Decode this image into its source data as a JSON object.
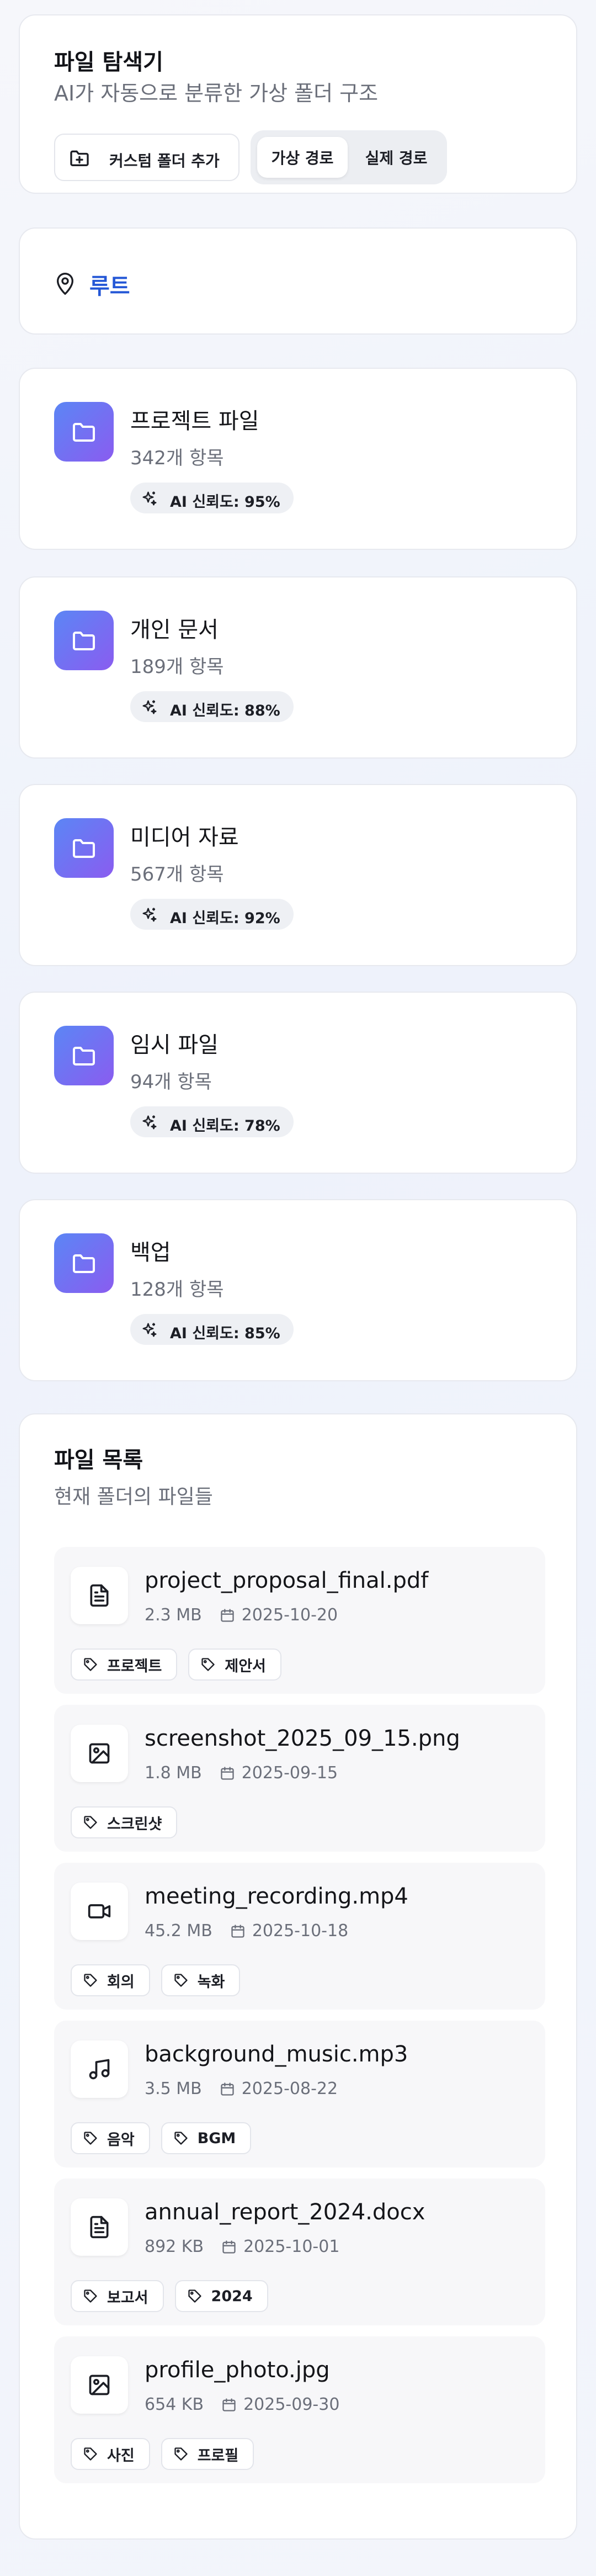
{
  "header": {
    "title": "파일 탐색기",
    "subtitle": "AI가 자동으로 분류한 가상 폴더 구조",
    "add_folder_label": "커스텀 폴더 추가",
    "toggle": {
      "virtual_label": "가상 경로",
      "real_label": "실제 경로",
      "selected": "가상 경로"
    }
  },
  "breadcrumb": {
    "root_label": "루트"
  },
  "folders": [
    {
      "name": "프로젝트 파일",
      "count": "342개 항목",
      "ai": "AI 신뢰도: 95%",
      "ai_confidence_percent": 95
    },
    {
      "name": "개인 문서",
      "count": "189개 항목",
      "ai": "AI 신뢰도: 88%",
      "ai_confidence_percent": 88
    },
    {
      "name": "미디어 자료",
      "count": "567개 항목",
      "ai": "AI 신뢰도: 92%",
      "ai_confidence_percent": 92
    },
    {
      "name": "임시 파일",
      "count": "94개 항목",
      "ai": "AI 신뢰도: 78%",
      "ai_confidence_percent": 78
    },
    {
      "name": "백업",
      "count": "128개 항목",
      "ai": "AI 신뢰도: 85%",
      "ai_confidence_percent": 85
    }
  ],
  "files_section": {
    "title": "파일 목록",
    "subtitle": "현재 폴더의 파일들"
  },
  "files": [
    {
      "name": "project_proposal_final.pdf",
      "size": "2.3 MB",
      "date": "2025-10-20",
      "icon": "document-icon",
      "tags": [
        "프로젝트",
        "제안서"
      ]
    },
    {
      "name": "screenshot_2025_09_15.png",
      "size": "1.8 MB",
      "date": "2025-09-15",
      "icon": "image-icon",
      "tags": [
        "스크린샷"
      ]
    },
    {
      "name": "meeting_recording.mp4",
      "size": "45.2 MB",
      "date": "2025-10-18",
      "icon": "video-icon",
      "tags": [
        "회의",
        "녹화"
      ]
    },
    {
      "name": "background_music.mp3",
      "size": "3.5 MB",
      "date": "2025-08-22",
      "icon": "music-icon",
      "tags": [
        "음악",
        "BGM"
      ]
    },
    {
      "name": "annual_report_2024.docx",
      "size": "892 KB",
      "date": "2025-10-01",
      "icon": "document-icon",
      "tags": [
        "보고서",
        "2024"
      ]
    },
    {
      "name": "profile_photo.jpg",
      "size": "654 KB",
      "date": "2025-09-30",
      "icon": "image-icon",
      "tags": [
        "사진",
        "프로필"
      ]
    }
  ],
  "colors": {
    "accent_blue": "#2457d6",
    "folder_gradient_start": "#5b86f5",
    "folder_gradient_end": "#8a5cf0"
  }
}
